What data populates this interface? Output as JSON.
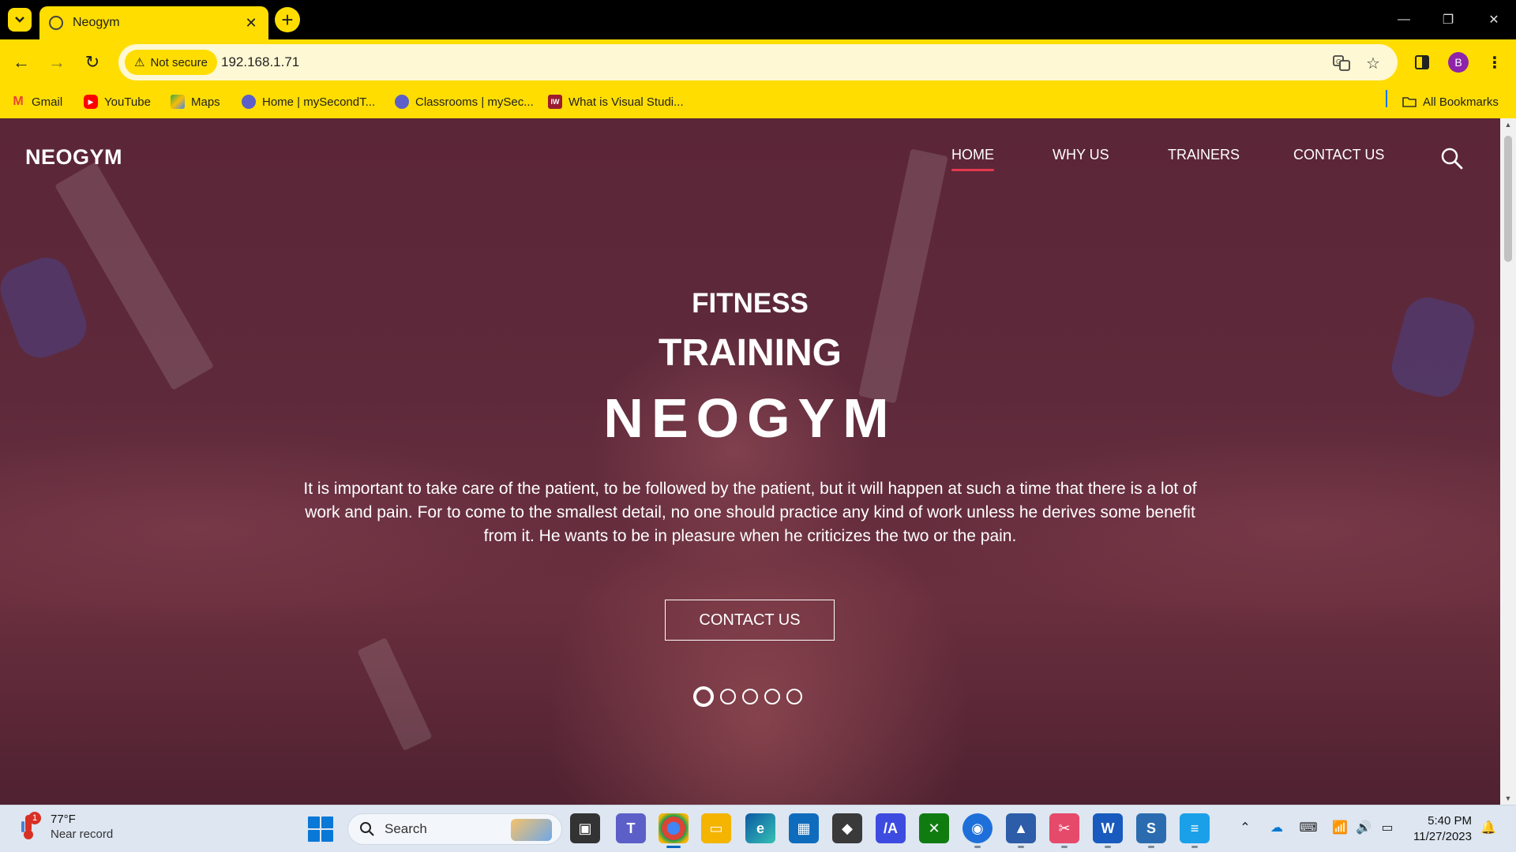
{
  "browser": {
    "tab_title": "Neogym",
    "address": {
      "security_label": "Not secure",
      "url": "192.168.1.71"
    },
    "profile_initial": "B",
    "bookmarks": [
      {
        "label": "Gmail",
        "icon": "gmail-icon",
        "color": "#EA4335"
      },
      {
        "label": "YouTube",
        "icon": "youtube-icon",
        "color": "#FF0000"
      },
      {
        "label": "Maps",
        "icon": "maps-icon",
        "color": "#34A853"
      },
      {
        "label": "Home | mySecondT...",
        "icon": "teams-edu-icon",
        "color": "#5B5FC7"
      },
      {
        "label": "Classrooms | mySec...",
        "icon": "teams-edu-icon",
        "color": "#5B5FC7"
      },
      {
        "label": "What is Visual Studi...",
        "icon": "iw-icon",
        "color": "#9B1B30"
      }
    ],
    "all_bookmarks_label": "All Bookmarks",
    "accent_color": "#FFDD00"
  },
  "site": {
    "logo": "NEOGYM",
    "nav": [
      {
        "label": "HOME",
        "active": true
      },
      {
        "label": "WHY US",
        "active": false
      },
      {
        "label": "TRAINERS",
        "active": false
      },
      {
        "label": "CONTACT US",
        "active": false
      }
    ],
    "hero": {
      "line1": "FITNESS",
      "line2": "TRAINING",
      "line3": "NEOGYM",
      "text": "It is important to take care of the patient, to be followed by the patient, but it will happen at such a time that there is a lot of work and pain. For to come to the smallest detail, no one should practice any kind of work unless he derives some benefit from it. He wants to be in pleasure when he criticizes the two or the pain.",
      "button": "CONTACT US",
      "slide_count": 5,
      "active_slide": 1
    },
    "overlay_color": "#5e2a3b",
    "nav_active_color": "#e63950"
  },
  "taskbar": {
    "weather": {
      "temp": "77°F",
      "desc": "Near record",
      "badge": "1"
    },
    "search_label": "Search",
    "time": "5:40 PM",
    "date": "11/27/2023"
  }
}
